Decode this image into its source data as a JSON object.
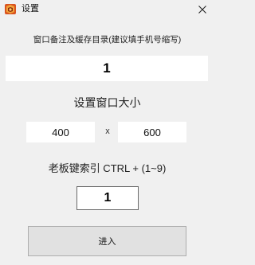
{
  "window": {
    "title": "设置",
    "icon": "app-logo-icon",
    "close_icon": "close-icon"
  },
  "directory": {
    "label": "窗口备注及缓存目录(建议填手机号缩写)",
    "value": "1"
  },
  "window_size": {
    "label": "设置窗口大小",
    "width": "400",
    "separator": "x",
    "height": "600"
  },
  "hotkey": {
    "label": "老板键索引 CTRL + (1~9)",
    "value": "1"
  },
  "actions": {
    "enter_label": "进入"
  },
  "colors": {
    "background": "#f0f0f0",
    "field": "#ffffff",
    "button": "#e1e1e1"
  }
}
